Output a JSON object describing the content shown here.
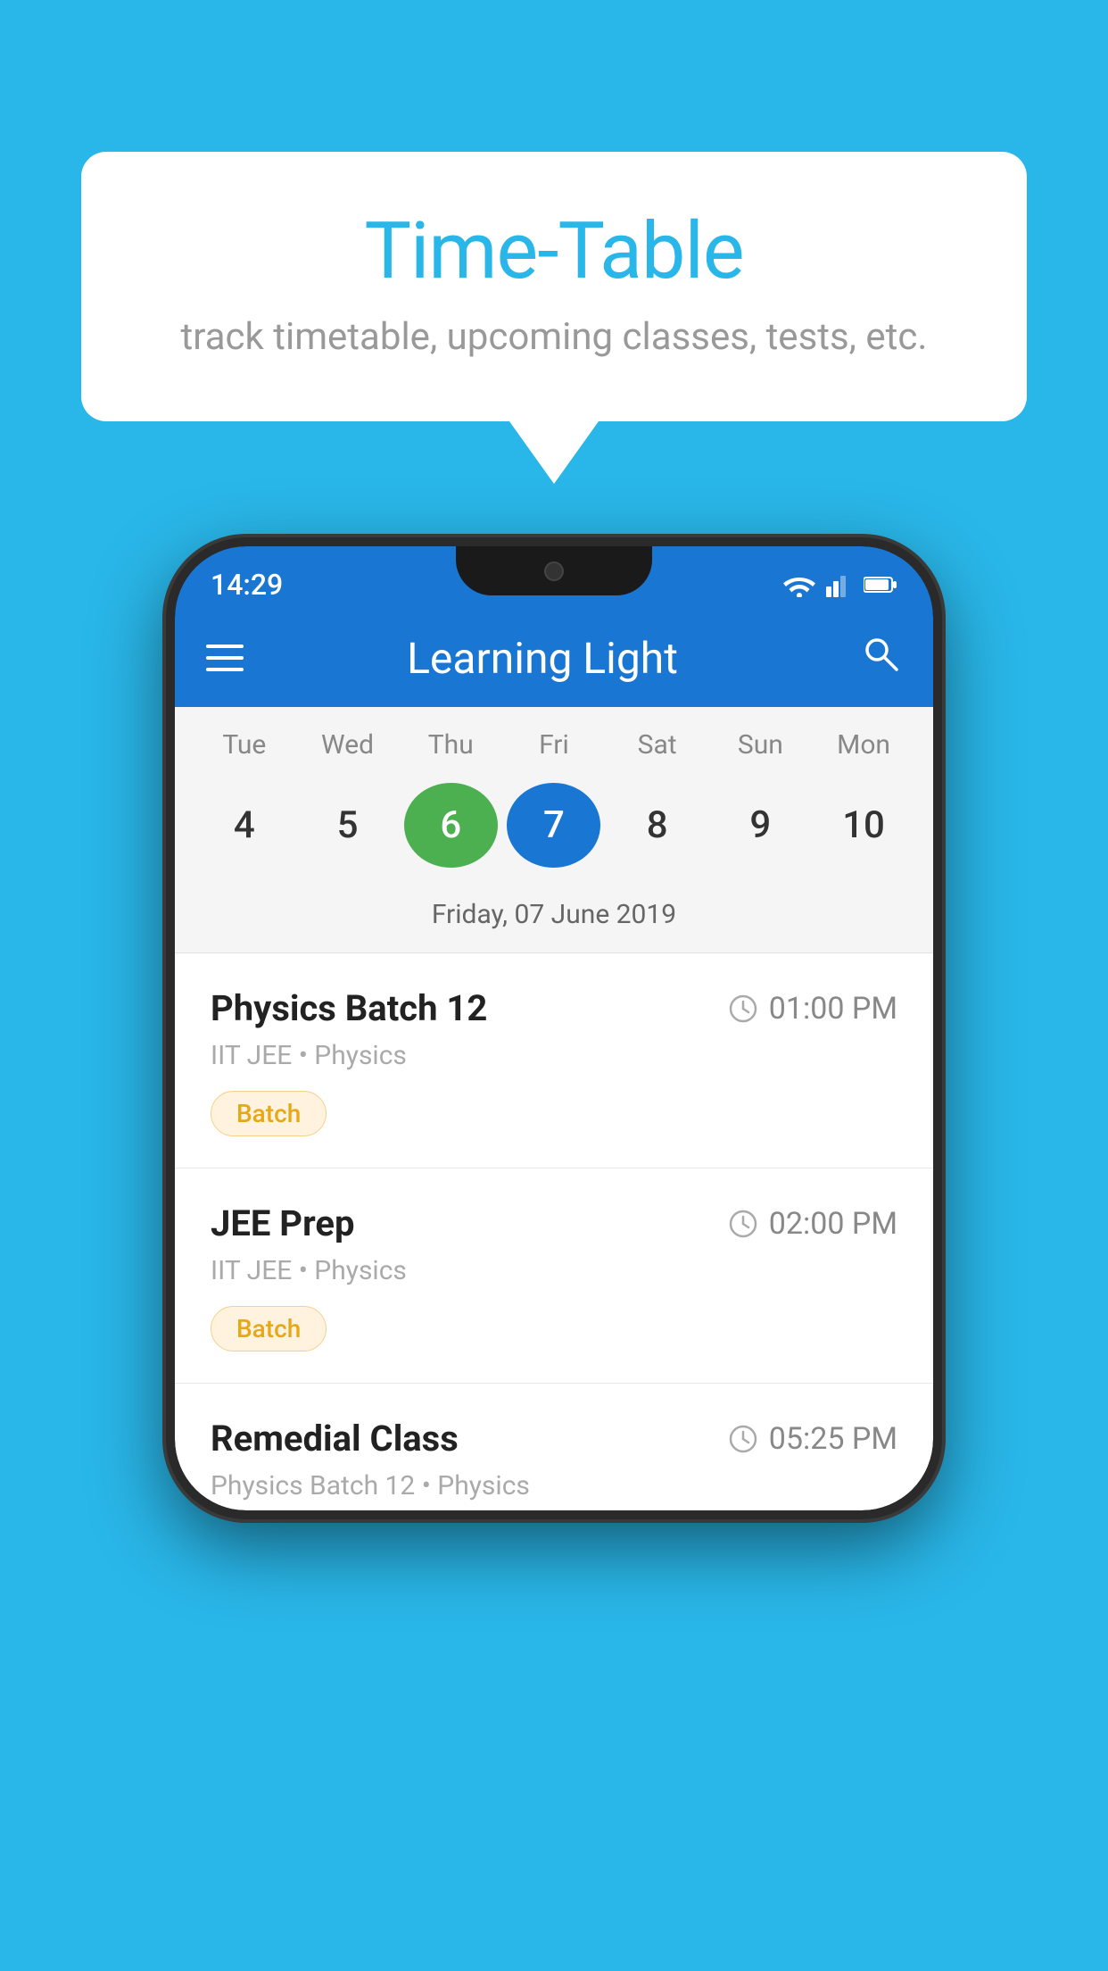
{
  "background_color": "#29B6E8",
  "speech_bubble": {
    "title": "Time-Table",
    "subtitle": "track timetable, upcoming classes, tests, etc."
  },
  "phone": {
    "status_bar": {
      "time": "14:29"
    },
    "app_bar": {
      "title": "Learning Light"
    },
    "calendar": {
      "day_names": [
        "Tue",
        "Wed",
        "Thu",
        "Fri",
        "Sat",
        "Sun",
        "Mon"
      ],
      "dates": [
        4,
        5,
        6,
        7,
        8,
        9,
        10
      ],
      "today_index": 2,
      "selected_index": 3,
      "selected_label": "Friday, 07 June 2019"
    },
    "schedule": [
      {
        "title": "Physics Batch 12",
        "time": "01:00 PM",
        "subtitle": "IIT JEE • Physics",
        "tag": "Batch"
      },
      {
        "title": "JEE Prep",
        "time": "02:00 PM",
        "subtitle": "IIT JEE • Physics",
        "tag": "Batch"
      },
      {
        "title": "Remedial Class",
        "time": "05:25 PM",
        "subtitle": "Physics Batch 12 • Physics",
        "tag": ""
      }
    ]
  },
  "icons": {
    "hamburger": "≡",
    "search": "🔍",
    "clock": "🕐"
  }
}
